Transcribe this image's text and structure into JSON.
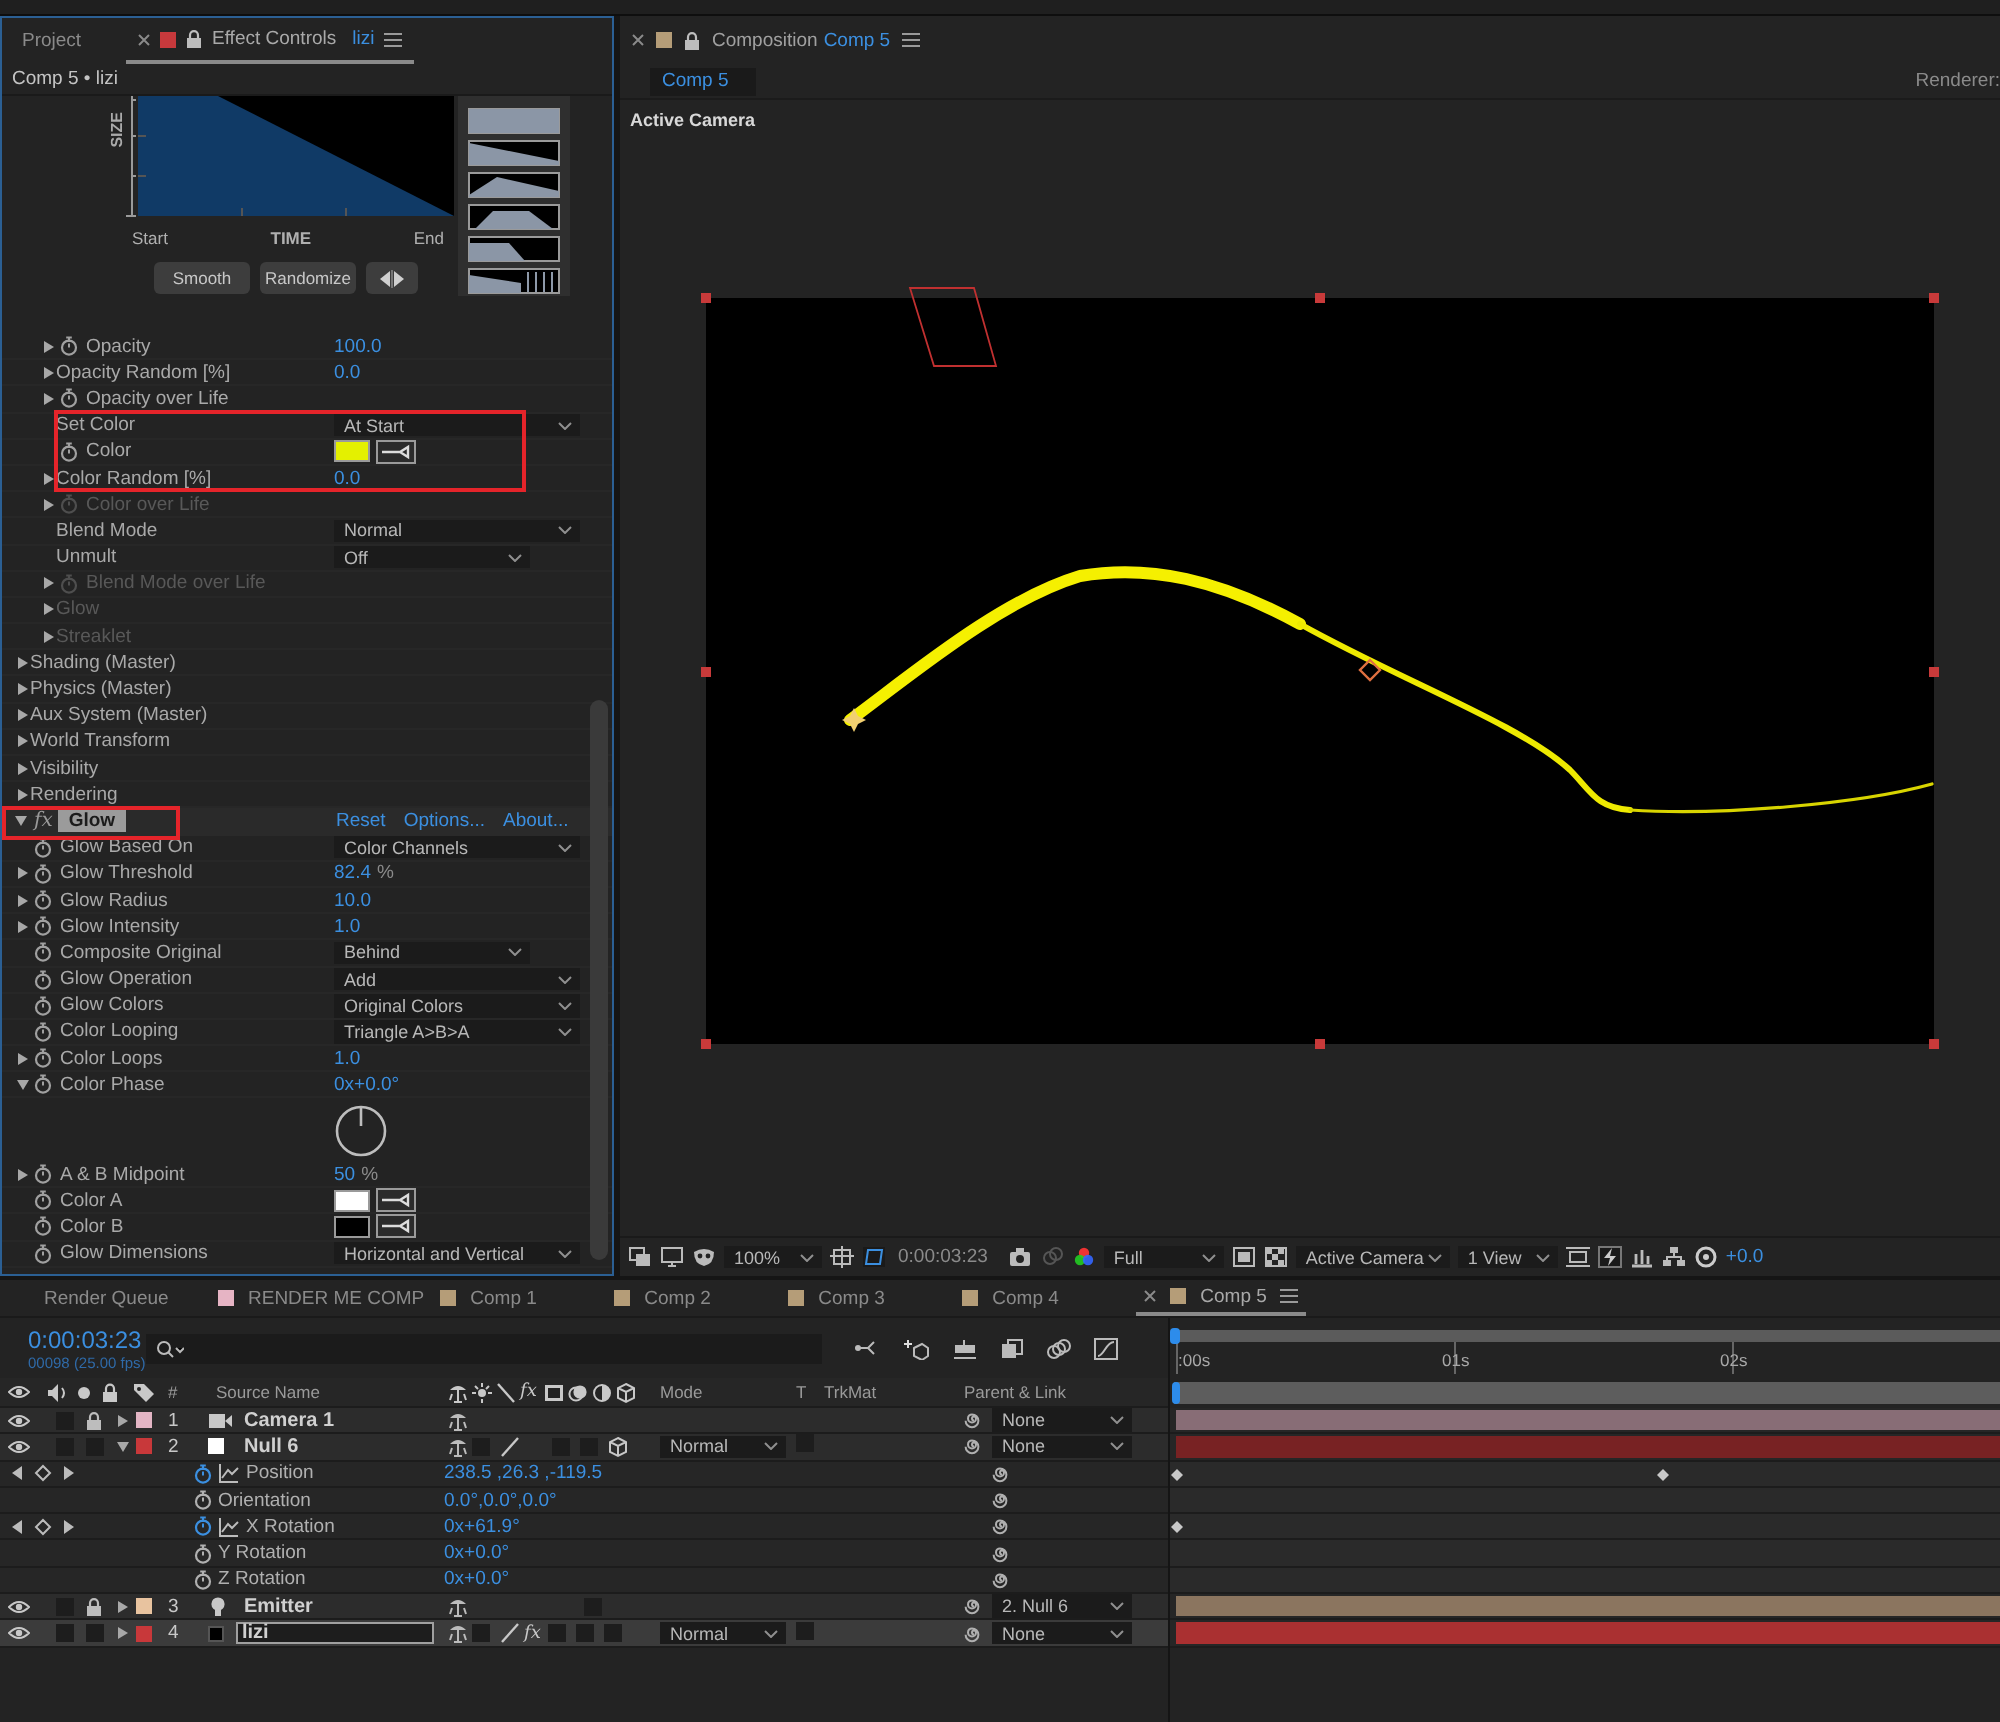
{
  "effect_controls_panel": {
    "tabs": [
      {
        "label": "Project",
        "selected": false
      },
      {
        "label": "Effect Controls",
        "target": "lizi",
        "color": "#c7393c",
        "selected": true
      }
    ],
    "breadcrumb": "Comp 5 • lizi",
    "size_graph": {
      "axis_label": "SIZE",
      "x_labels": [
        "Start",
        "TIME",
        "End"
      ],
      "buttons": [
        "Smooth",
        "Randomize"
      ],
      "presets": [
        {
          "kind": "constant"
        },
        {
          "kind": "fade_out"
        },
        {
          "kind": "peak"
        },
        {
          "kind": "plateau"
        },
        {
          "kind": "drop"
        },
        {
          "kind": "stepped"
        }
      ]
    },
    "rows": [
      {
        "children": [
          {
            "name": "Opacity",
            "kind": "number",
            "value": "100.0",
            "expanded": false,
            "stopwatch": true,
            "disabled": false,
            "annotated": false
          },
          {
            "name": "Opacity Random [%]",
            "kind": "number",
            "value": "0.0",
            "expanded": false,
            "stopwatch": false,
            "disabled": false,
            "annotated": false
          },
          {
            "name": "Opacity over Life",
            "expanded": false,
            "stopwatch": true,
            "disabled": false,
            "annotated": false
          },
          {
            "name": "Set Color",
            "kind": "dropdown",
            "value": "At Start",
            "stopwatch": false,
            "disabled": false,
            "annotated": true
          },
          {
            "name": "Color",
            "kind": "color",
            "color": "#e4f000",
            "stopwatch": true,
            "disabled": false,
            "annotated": true
          },
          {
            "name": "Color Random [%]",
            "kind": "number",
            "value": "0.0",
            "expanded": false,
            "stopwatch": false,
            "disabled": false,
            "annotated": true
          },
          {
            "name": "Color over Life",
            "expanded": false,
            "stopwatch": true,
            "disabled": true,
            "annotated": false
          },
          {
            "name": "Blend Mode",
            "kind": "dropdown",
            "value": "Normal",
            "stopwatch": false,
            "disabled": false,
            "annotated": false
          },
          {
            "name": "Unmult",
            "kind": "dropdown_short",
            "value": "Off",
            "stopwatch": false,
            "disabled": false,
            "annotated": false
          },
          {
            "name": "Blend Mode over Life",
            "expanded": false,
            "stopwatch": true,
            "disabled": true,
            "annotated": false
          },
          {
            "name": "Glow",
            "expanded": false,
            "stopwatch": false,
            "disabled": true,
            "annotated": false
          },
          {
            "name": "Streaklet",
            "expanded": false,
            "stopwatch": false,
            "disabled": true,
            "annotated": false
          }
        ]
      },
      {
        "name": "Shading (Master)",
        "expanded": false,
        "stopwatch": false,
        "disabled": false
      },
      {
        "name": "Physics (Master)",
        "expanded": false,
        "stopwatch": false,
        "disabled": false
      },
      {
        "name": "Aux System (Master)",
        "expanded": false,
        "stopwatch": false,
        "disabled": false
      },
      {
        "name": "World Transform",
        "expanded": false,
        "stopwatch": false,
        "disabled": false
      },
      {
        "name": "Visibility",
        "expanded": false,
        "stopwatch": false,
        "disabled": false
      },
      {
        "name": "Rendering",
        "expanded": false,
        "stopwatch": false,
        "disabled": false
      }
    ],
    "effects": [
      {
        "badge": "fx",
        "name": "Glow",
        "expanded": true,
        "annotated": true,
        "links": [
          "Reset",
          "Options...",
          "About..."
        ],
        "rows": [
          {
            "name": "Glow Based On",
            "kind": "dropdown",
            "value": "Color Channels",
            "stopwatch": true,
            "disabled": false
          },
          {
            "name": "Glow Threshold",
            "kind": "number",
            "value": "82.4",
            "unit": "%",
            "expanded": false,
            "stopwatch": true,
            "disabled": false
          },
          {
            "name": "Glow Radius",
            "kind": "number",
            "value": "10.0",
            "expanded": false,
            "stopwatch": true,
            "disabled": false
          },
          {
            "name": "Glow Intensity",
            "kind": "number",
            "value": "1.0",
            "expanded": false,
            "stopwatch": true,
            "disabled": false
          },
          {
            "name": "Composite Original",
            "kind": "dropdown_short",
            "value": "Behind",
            "stopwatch": true,
            "disabled": false
          },
          {
            "name": "Glow Operation",
            "kind": "dropdown",
            "value": "Add",
            "stopwatch": true,
            "disabled": false
          },
          {
            "name": "Glow Colors",
            "kind": "dropdown",
            "value": "Original Colors",
            "stopwatch": true,
            "disabled": false
          },
          {
            "name": "Color Looping",
            "kind": "dropdown",
            "value": "Triangle A>B>A",
            "stopwatch": true,
            "disabled": false
          },
          {
            "name": "Color Loops",
            "kind": "number",
            "value": "1.0",
            "expanded": false,
            "stopwatch": true,
            "disabled": false
          },
          {
            "name": "Color Phase",
            "kind": "number",
            "value": "0x+0.0°",
            "expanded": true,
            "stopwatch": true,
            "disabled": false,
            "children": [
              {
                "kind": "dial"
              }
            ]
          },
          {
            "name": "A & B Midpoint",
            "kind": "number",
            "value": "50",
            "unit": "%",
            "expanded": false,
            "stopwatch": true,
            "disabled": false
          },
          {
            "name": "Color A",
            "kind": "color",
            "color": "#ffffff",
            "stopwatch": true,
            "disabled": false
          },
          {
            "name": "Color B",
            "kind": "color",
            "color": "#000000",
            "stopwatch": true,
            "disabled": false
          },
          {
            "name": "Glow Dimensions",
            "kind": "dropdown",
            "value": "Horizontal and Vertical",
            "stopwatch": true,
            "disabled": false
          }
        ]
      }
    ]
  },
  "composition_panel": {
    "tabs": [
      {
        "prefix": "Composition",
        "label": "Comp 5",
        "color": "#b59d78",
        "selected": true
      }
    ],
    "breadcrumb": "Comp 5",
    "renderer_label": "Renderer:",
    "view_label": "Active Camera",
    "toolbar": {
      "zoom": "100%",
      "timecode": "0:00:03:23",
      "resolution": "Full",
      "camera": "Active Camera",
      "views": "1 View",
      "exposure": "+0.0"
    }
  },
  "timeline_panel": {
    "tabs": [
      {
        "label": "Render Queue",
        "selected": false
      },
      {
        "label": "RENDER ME COMP",
        "color": "#e6b4c4",
        "selected": false
      },
      {
        "label": "Comp 1",
        "color": "#b59d78",
        "selected": false
      },
      {
        "label": "Comp 2",
        "color": "#b59d78",
        "selected": false
      },
      {
        "label": "Comp 3",
        "color": "#b59d78",
        "selected": false
      },
      {
        "label": "Comp 4",
        "color": "#b59d78",
        "selected": false
      },
      {
        "label": "Comp 5",
        "color": "#b59d78",
        "selected": true
      }
    ],
    "timecode": "0:00:03:23",
    "frame_info": "00098 (25.00 fps)",
    "ruler": [
      ":00s",
      "01s",
      "02s"
    ],
    "columns": {
      "number": "#",
      "source_name": "Source Name",
      "switch_fx": "fx",
      "mode": "Mode",
      "track_matte_toggle": "T",
      "track_matte": "TrkMat",
      "parent": "Parent & Link"
    },
    "layers": [
      {
        "number": "1",
        "name": "Camera 1",
        "kind": "camera",
        "color": "#e3b5c4",
        "locked": true,
        "expanded": false,
        "selected": false,
        "editing": false,
        "switches": [
          {
            "kind": "shy"
          }
        ],
        "parent": "None"
      },
      {
        "number": "2",
        "name": "Null 6",
        "kind": "null",
        "color": "#c8383a",
        "locked": false,
        "expanded": true,
        "selected": false,
        "editing": false,
        "switches": [
          {
            "kind": "shy"
          },
          {
            "kind": "empty"
          },
          {
            "kind": "quality"
          },
          {
            "kind": "none"
          },
          {
            "kind": "empty"
          },
          {
            "kind": "empty"
          },
          {
            "kind": "three_d"
          }
        ],
        "mode": "Normal",
        "parent": "None",
        "properties": [
          {
            "name": "Position",
            "value": "238.5 ,26.3 ,-119.5",
            "animated": true,
            "keyframes": [
              {
                "level": 0
              },
              {
                "level": 0.578
              }
            ]
          },
          {
            "name": "Orientation",
            "value": "0.0°,0.0°,0.0°",
            "animated": false
          },
          {
            "name": "X Rotation",
            "value": "0x+61.9°",
            "animated": true,
            "keyframes": [
              {
                "level": 0
              }
            ]
          },
          {
            "name": "Y Rotation",
            "value": "0x+0.0°",
            "animated": false
          },
          {
            "name": "Z Rotation",
            "value": "0x+0.0°",
            "animated": false
          }
        ]
      },
      {
        "number": "3",
        "name": "Emitter",
        "kind": "light",
        "color": "#e8c39f",
        "locked": true,
        "expanded": false,
        "selected": false,
        "editing": false,
        "switches": [
          {
            "kind": "shy"
          },
          {
            "kind": "none"
          },
          {
            "kind": "none"
          },
          {
            "kind": "none"
          },
          {
            "kind": "none"
          },
          {
            "kind": "empty"
          }
        ],
        "parent": "2. Null 6"
      },
      {
        "number": "4",
        "name": "lizi",
        "kind": "solid",
        "color": "#c8383a",
        "locked": false,
        "expanded": false,
        "selected": true,
        "editing": true,
        "switches": [
          {
            "kind": "shy"
          },
          {
            "kind": "empty"
          },
          {
            "kind": "quality"
          },
          {
            "kind": "effect",
            "label": "fx"
          },
          {
            "kind": "empty"
          },
          {
            "kind": "empty"
          },
          {
            "kind": "empty"
          }
        ],
        "mode": "Normal",
        "parent": "None"
      }
    ]
  }
}
